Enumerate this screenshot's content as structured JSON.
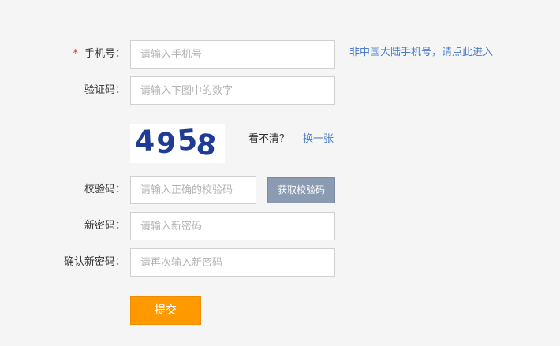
{
  "form": {
    "phone": {
      "required_mark": "*",
      "label": "手机号：",
      "placeholder": "请输入手机号",
      "value": "",
      "foreign_link": "非中国大陆手机号，请点此进入"
    },
    "captcha": {
      "label": "验证码：",
      "placeholder": "请输入下图中的数字",
      "value": "",
      "image_text": "4958",
      "image_color": "#1e3c96",
      "hint": "看不清？",
      "refresh_link": "换一张"
    },
    "sms_code": {
      "label": "校验码：",
      "placeholder": "请输入正确的校验码",
      "value": "",
      "button": "获取校验码"
    },
    "new_password": {
      "label": "新密码：",
      "placeholder": "请输入新密码",
      "value": ""
    },
    "confirm_password": {
      "label": "确认新密码：",
      "placeholder": "请再次输入新密码",
      "value": ""
    },
    "submit": "提交"
  },
  "colors": {
    "background": "#f5f5f5",
    "link": "#4a7cc9",
    "required": "#e53333",
    "sms_button": "#8a9bb2",
    "submit_button": "#ff9900"
  }
}
